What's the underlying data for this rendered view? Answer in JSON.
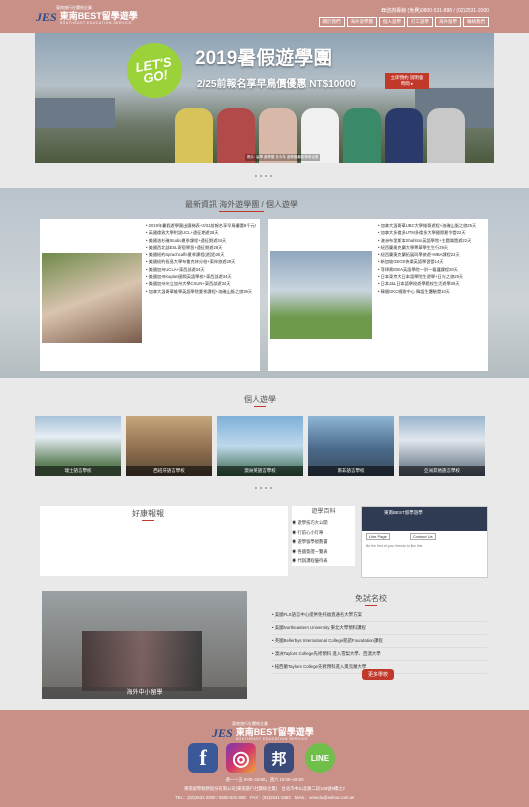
{
  "header": {
    "logo_mark": "JES",
    "logo_sub": "東南旅行社關係企業",
    "logo_name": "東南BEST留學遊學",
    "logo_en": "SOUTHEAST EDUCATION SERVICE",
    "contact": "☎諮詢專線 (免費)0800-531-888 / (02)2531-2000",
    "nav": [
      "關於我們",
      "海外遊學團",
      "個人遊學",
      "打工遊學",
      "海外留學",
      "聯絡我們"
    ]
  },
  "hero": {
    "badge": "LET'S GO!",
    "title": "2019暑假遊學團",
    "subtitle": "2/25前報名享早鳥價優惠 NT$10000",
    "button": "立即預約 說明會時間 ▸",
    "caption": "照片: 留學 遊學團 至今年 遊學團最新學員合照"
  },
  "news": {
    "heading": "最新資訊 海外遊學團 / 個人遊學",
    "left_list": [
      "2019年暑假遊學團出團梯表+3/31前報名享早鳥優惠8千元!",
      "英國倫敦大學附設UCL+遠征期遊28天",
      "美國洛杉磯Studio夏季課程+遠征期遊34天",
      "美國西北部ESL寄宿學習+遠征期遊28天",
      "美國紐約Sprachcaffe夏季課程(遊說)30天",
      "美國紐約長島大學布魯克林分校+東岸旅遊29天",
      "美國加州UCLA+東西部遊34天",
      "美國加州Kaplan國際英語學校+東西部遊34天",
      "美國加州州立加州大學CSUN+東西部遊34天",
      "加拿大溫哥華維學英語學院夏季課程+洛磯山脈之旅39天"
    ],
    "right_list": [
      "加拿大溫哥華UBC大學維哥遊程+洛磯山脈之旅25天",
      "加拿大多倫多UTM多倫多大學國際夏令營22天",
      "澳洲布里斯本Shafston英語學院+主題樂園遊22天",
      "紐西蘭奧克蘭大學菁華學生生行29天",
      "紐西蘭奧克蘭拓展同學旅遊+MBA課程22天",
      "新加坡GEOS快樂英語學習營14天",
      "菲律賓IDEA英語學院一對一看護課程28天",
      "日本東京大日本語學院生遊學+日光之旅29天",
      "日本J&L日本語學校遊學館校生活遊學35天",
      "韓國GKC唱歌中心 韓語生體驗營10天"
    ]
  },
  "personal": {
    "heading": "個人遊學",
    "tiles": [
      "瑞士語言學校",
      "西班牙語言學校",
      "澳洲英語言學校",
      "南非語言學校",
      "亞洲其他語言學校"
    ]
  },
  "reviews": {
    "heading": "好康報報"
  },
  "wiki": {
    "heading": "遊學百科",
    "items": [
      "遊學技巧大公開",
      "行前心小叮嚀",
      "遊學留學規劃書",
      "各國簽證一覽表",
      "代辦課程優待表"
    ]
  },
  "facebook": {
    "page_name": "東南BEST留學遊學",
    "like": "Like Page",
    "contact": "Contact Us",
    "prompt": "Be the first of your friends to like this"
  },
  "study_abroad": {
    "caption": "海外中小留學"
  },
  "free_school": {
    "heading": "免試名校",
    "rows": [
      "美國FLS語言中心提供免托福直通名大學方案",
      "美國Northeastern University 東北大學預科課程",
      "英國Bellerbys International College凱諾Foundation課程",
      "澳洲Taylors College先修預科 進入雪梨大學、西澳大學",
      "紐西蘭Taylors College先修預科進入奧克蘭大學"
    ],
    "more": "更多學校"
  },
  "footer": {
    "hours": "週一～五 9:00~19:00，週六 10:00~16:00",
    "company": "東南留學服務股份有限公司(東南旅行社關係企業)　台北市中山北路二段105號9樓之2",
    "tel": "TEL：(02)2531-2000 / 0800-531-888　FAX：(02)2531-3353　MAIL：sesedu@sefour.com.tw",
    "social": [
      "f",
      "◎",
      "邦",
      "LINE"
    ]
  },
  "colors": {
    "brand": "#c99088",
    "accent": "#c0392b",
    "navy": "#2a4a8a"
  }
}
